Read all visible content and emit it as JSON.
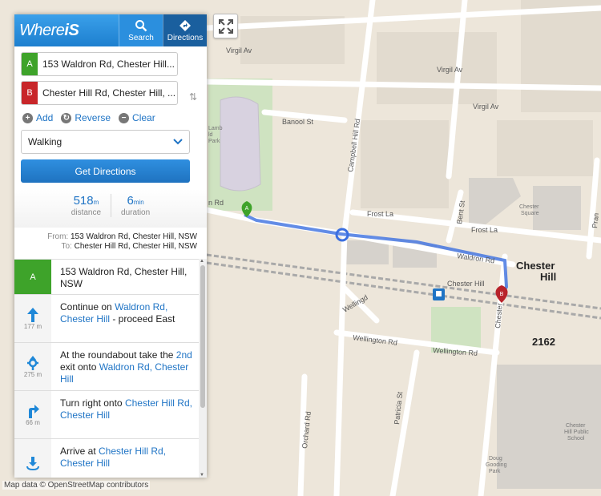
{
  "header": {
    "logo_where": "Where",
    "logo_is": "iS",
    "search_label": "Search",
    "directions_label": "Directions"
  },
  "route_form": {
    "from": {
      "marker": "A",
      "value": "153 Waldron Rd, Chester Hill..."
    },
    "to": {
      "marker": "B",
      "value": "Chester Hill Rd, Chester Hill, ..."
    },
    "add_label": "Add",
    "reverse_label": "Reverse",
    "clear_label": "Clear",
    "mode": "Walking",
    "submit_label": "Get Directions"
  },
  "summary": {
    "distance_value": "518",
    "distance_unit": "m",
    "distance_label": "distance",
    "duration_value": "6",
    "duration_unit": "min",
    "duration_label": "duration",
    "from_key": "From:",
    "from_value": "153 Waldron Rd, Chester Hill, NSW",
    "to_key": "To:",
    "to_value": "Chester Hill Rd, Chester Hill, NSW"
  },
  "steps": [
    {
      "icon": "marker-a-icon",
      "marker": "A",
      "dist": "",
      "text1": "153 Waldron Rd, Chester Hill, NSW",
      "link1": "",
      "text2": "",
      "link2": "",
      "text3": ""
    },
    {
      "icon": "arrow-up-icon",
      "dist": "177 m",
      "text1": "Continue on ",
      "link1": "Waldron Rd, Chester Hill",
      "text2": " - proceed East",
      "link2": "",
      "text3": ""
    },
    {
      "icon": "roundabout-icon",
      "dist": "275 m",
      "text1": "At the roundabout take the ",
      "link1": "2nd",
      "text2": " exit onto ",
      "link2": "Waldron Rd, Chester Hill",
      "text3": ""
    },
    {
      "icon": "turn-right-icon",
      "dist": "66 m",
      "text1": "Turn right onto ",
      "link1": "Chester Hill Rd, Chester Hill",
      "text2": "",
      "link2": "",
      "text3": ""
    },
    {
      "icon": "arrive-icon",
      "dist": "",
      "text1": "Arrive at ",
      "link1": "Chester Hill Rd, Chester Hill",
      "text2": "",
      "link2": "",
      "text3": ""
    }
  ],
  "map": {
    "streets": {
      "virgil1": "Virgil Av",
      "virgil2": "Virgil Av",
      "virgil3": "Virgil Av",
      "banool": "Banool St",
      "campbell": "Campbell Hill Rd",
      "frost1": "Frost La",
      "frost2": "Frost La",
      "bent": "Bent St",
      "waldron_left": "n Rd",
      "waldron": "Waldron Rd",
      "chesterhill_st": "Chester Hill",
      "chester_rd": "Chester",
      "wellington1": "Wellington Rd",
      "wellington2": "Wellington Rd",
      "welldy": "Wellingd",
      "patricia": "Patricia St",
      "orchard": "Orchard Rd",
      "pran": "Pran",
      "park": "Park"
    },
    "suburb1": "Chester",
    "suburb2": "Hill",
    "postcode": "2162",
    "poi_square1": "Chester",
    "poi_square2": "Square",
    "poi_school1": "Chester",
    "poi_school2": "Hill Public",
    "poi_school3": "School",
    "poi_doug1": "Doug",
    "poi_doug2": "Gooding",
    "poi_doug3": "Park",
    "poi_lamb1": "Lamb",
    "poi_lamb2": "ld",
    "poi_lamb3": "Park",
    "marker_a": "A",
    "marker_b": "B"
  },
  "attribution": "Map data © OpenStreetMap contributors",
  "colors": {
    "route": "#3b6fe0",
    "accent": "#1f74c5",
    "marker_a": "#3ea32a",
    "marker_b": "#c8262a"
  }
}
